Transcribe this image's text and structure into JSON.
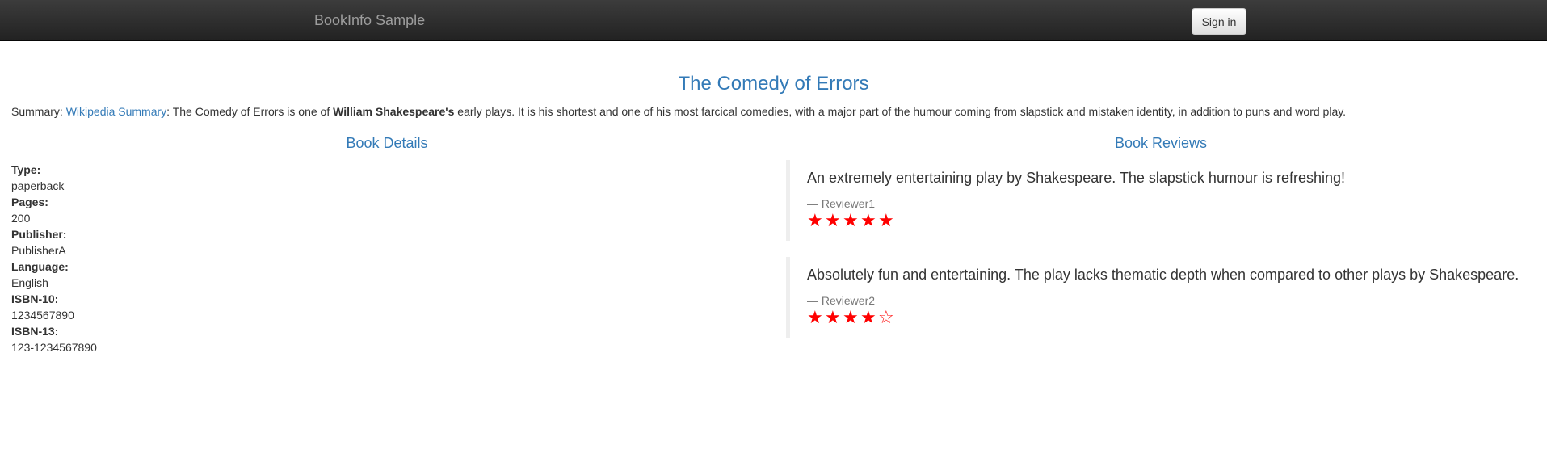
{
  "navbar": {
    "brand": "BookInfo Sample",
    "signin_label": "Sign in"
  },
  "book": {
    "title": "The Comedy of Errors",
    "summary_prefix": "Summary: ",
    "summary_link": "Wikipedia Summary",
    "summary_mid": ": The Comedy of Errors is one of ",
    "summary_author": "William Shakespeare's",
    "summary_rest": " early plays. It is his shortest and one of his most farcical comedies, with a major part of the humour coming from slapstick and mistaken identity, in addition to puns and word play."
  },
  "details": {
    "heading": "Book Details",
    "fields": [
      {
        "label": "Type:",
        "value": "paperback"
      },
      {
        "label": "Pages:",
        "value": "200"
      },
      {
        "label": "Publisher:",
        "value": "PublisherA"
      },
      {
        "label": "Language:",
        "value": "English"
      },
      {
        "label": "ISBN-10:",
        "value": "1234567890"
      },
      {
        "label": "ISBN-13:",
        "value": "123-1234567890"
      }
    ]
  },
  "reviews": {
    "heading": "Book Reviews",
    "star_color": "#ff0000",
    "items": [
      {
        "text": "An extremely entertaining play by Shakespeare. The slapstick humour is refreshing!",
        "reviewer": "— Reviewer1",
        "rating": 5,
        "max_rating": 5
      },
      {
        "text": "Absolutely fun and entertaining. The play lacks thematic depth when compared to other plays by Shakespeare.",
        "reviewer": "— Reviewer2",
        "rating": 4,
        "max_rating": 5
      }
    ]
  }
}
